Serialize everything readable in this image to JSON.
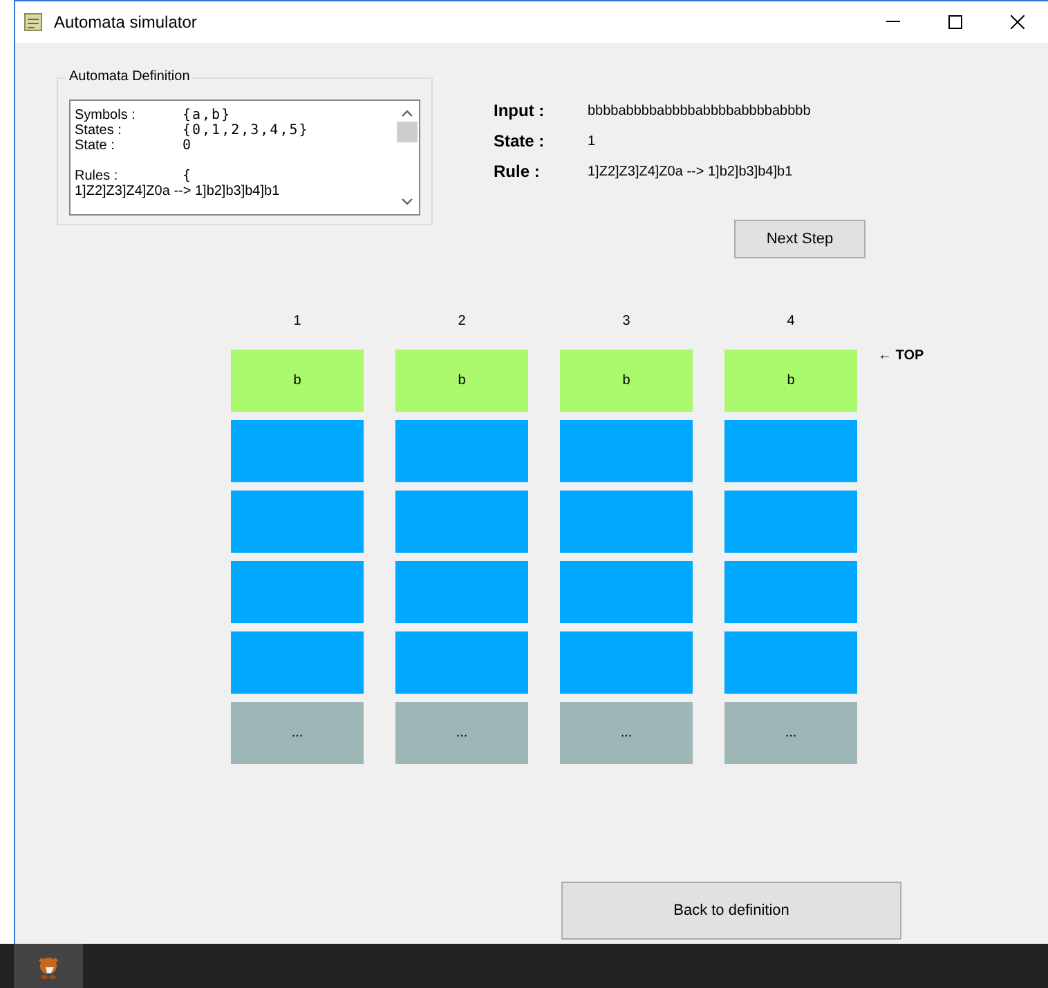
{
  "window": {
    "title": "Automata simulator"
  },
  "definition": {
    "title": "Automata Definition",
    "lines": [
      {
        "kind": "pair",
        "label": "Symbols :",
        "value": "{a,b}"
      },
      {
        "kind": "pair",
        "label": "States :",
        "value": "{0,1,2,3,4,5}"
      },
      {
        "kind": "pair",
        "label": "State :",
        "value": "0"
      },
      {
        "kind": "blank"
      },
      {
        "kind": "pair",
        "label": "Rules :",
        "value": "{"
      },
      {
        "kind": "text",
        "label": "1]Z2]Z3]Z4]Z0a --> 1]b2]b3]b4]b1"
      }
    ]
  },
  "info": [
    {
      "label": "Input :",
      "value": "bbbbabbbbabbbbabbbbabbbbabbbb"
    },
    {
      "label": "State :",
      "value": "1"
    },
    {
      "label": "Rule :",
      "value": "1]Z2]Z3]Z4]Z0a --> 1]b2]b3]b4]b1"
    }
  ],
  "next_button": "Next Step",
  "top_marker": "← TOP",
  "stacks": [
    {
      "label": "1",
      "cells": [
        {
          "kind": "top",
          "text": "b"
        },
        {
          "kind": "empty"
        },
        {
          "kind": "empty"
        },
        {
          "kind": "empty"
        },
        {
          "kind": "empty"
        },
        {
          "kind": "more",
          "text": "..."
        }
      ]
    },
    {
      "label": "2",
      "cells": [
        {
          "kind": "top",
          "text": "b"
        },
        {
          "kind": "empty"
        },
        {
          "kind": "empty"
        },
        {
          "kind": "empty"
        },
        {
          "kind": "empty"
        },
        {
          "kind": "more",
          "text": "..."
        }
      ]
    },
    {
      "label": "3",
      "cells": [
        {
          "kind": "top",
          "text": "b"
        },
        {
          "kind": "empty"
        },
        {
          "kind": "empty"
        },
        {
          "kind": "empty"
        },
        {
          "kind": "empty"
        },
        {
          "kind": "more",
          "text": "..."
        }
      ]
    },
    {
      "label": "4",
      "cells": [
        {
          "kind": "top",
          "text": "b"
        },
        {
          "kind": "empty"
        },
        {
          "kind": "empty"
        },
        {
          "kind": "empty"
        },
        {
          "kind": "empty"
        },
        {
          "kind": "more",
          "text": "..."
        }
      ]
    }
  ],
  "back_button": "Back to definition"
}
